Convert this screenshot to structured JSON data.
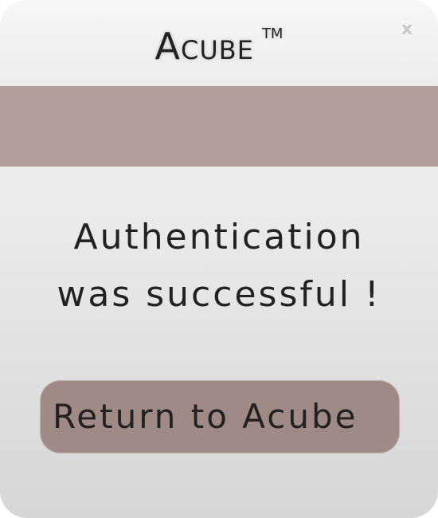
{
  "header": {
    "brand": "Acube",
    "trademark": "TM",
    "close_label": "x"
  },
  "message": {
    "line1": "Authentication",
    "line2": "was successful !"
  },
  "button": {
    "label": "Return to Acube"
  },
  "colors": {
    "accent_band": "#b29e9b",
    "button_bg": "#a08a86"
  },
  "icons": {
    "close": "close-icon"
  }
}
